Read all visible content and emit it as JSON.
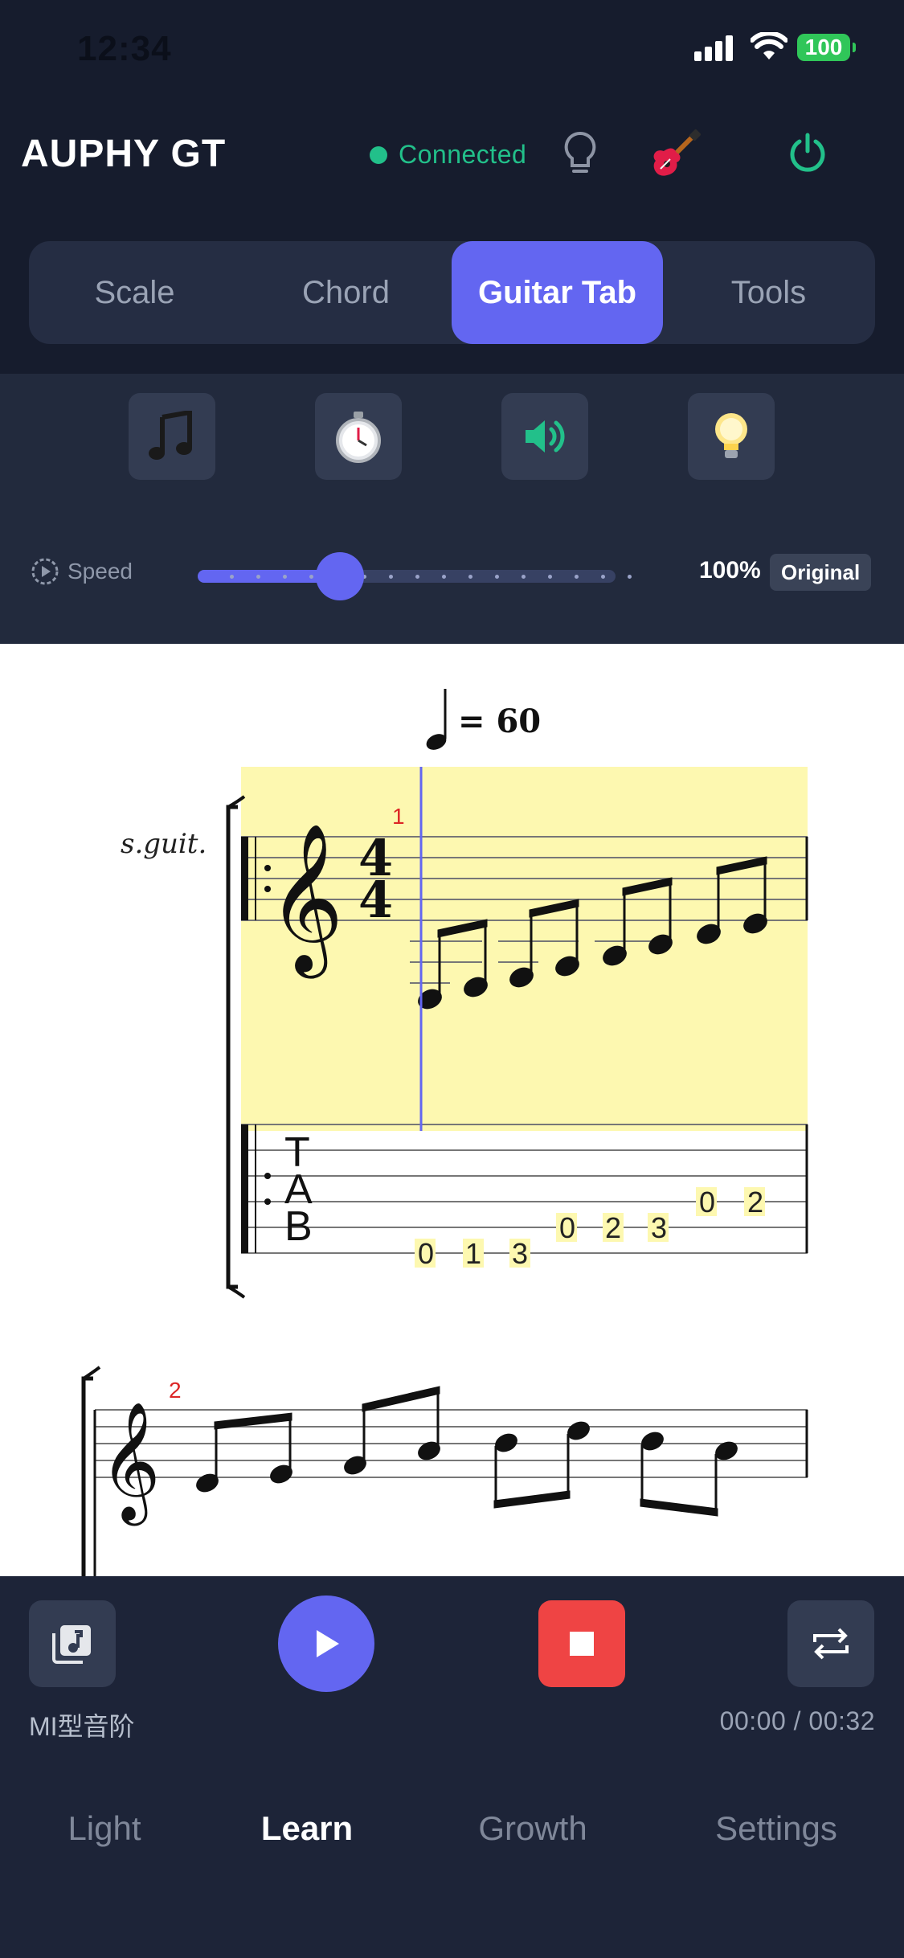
{
  "status_bar": {
    "time": "12:34",
    "battery": "100"
  },
  "header": {
    "title": "AUPHY GT",
    "connection_status": "Connected",
    "colors": {
      "connected": "#22c08a",
      "accent": "#6366f1",
      "stop": "#ef4444"
    }
  },
  "mode_tabs": [
    {
      "label": "Scale",
      "active": false
    },
    {
      "label": "Chord",
      "active": false
    },
    {
      "label": "Guitar Tab",
      "active": true
    },
    {
      "label": "Tools",
      "active": false
    }
  ],
  "tools": {
    "icons": [
      "music-note-icon",
      "stopwatch-icon",
      "speaker-icon",
      "light-bulb-icon"
    ],
    "speed_label": "Speed",
    "speed_value": "100%",
    "speed_badge": "Original",
    "speed_slider_fraction": 0.34
  },
  "score": {
    "tempo": "= 60",
    "instrument": "s.guit.",
    "time_signature": [
      "4",
      "4"
    ],
    "tab_clef": [
      "T",
      "A",
      "B"
    ],
    "measure_1_number": "1",
    "measure_2_number": "2",
    "tab_numbers": [
      "0",
      "1",
      "3",
      "0",
      "2",
      "3",
      "0",
      "2"
    ]
  },
  "player": {
    "song_name": "MI型音阶",
    "time": "00:00 / 00:32"
  },
  "bottom_nav": [
    {
      "label": "Light",
      "active": false
    },
    {
      "label": "Learn",
      "active": true
    },
    {
      "label": "Growth",
      "active": false
    },
    {
      "label": "Settings",
      "active": false
    }
  ]
}
